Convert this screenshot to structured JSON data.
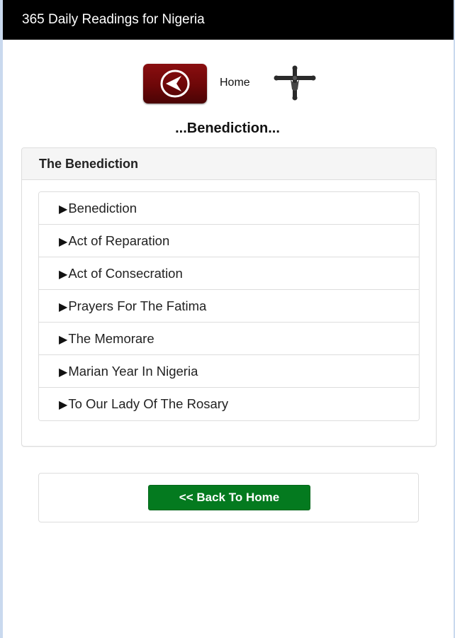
{
  "app": {
    "title": "365 Daily Readings for Nigeria"
  },
  "nav": {
    "back_icon": "back-arrow-icon",
    "home_label": "Home",
    "decoration_icon": "crucifix-icon"
  },
  "page": {
    "title": "...Benediction..."
  },
  "panel": {
    "heading": "The Benediction",
    "item_marker": "▶",
    "items": [
      {
        "label": "Benediction"
      },
      {
        "label": "Act of Reparation"
      },
      {
        "label": "Act of Consecration"
      },
      {
        "label": "Prayers For The Fatima"
      },
      {
        "label": "The Memorare"
      },
      {
        "label": "Marian Year In Nigeria"
      },
      {
        "label": "To Our Lady Of The Rosary"
      }
    ]
  },
  "footer": {
    "back_home_label": "<< Back To Home"
  },
  "colors": {
    "titlebar": "#000000",
    "back_icon": "#7a0a0c",
    "button": "#047a1f"
  }
}
